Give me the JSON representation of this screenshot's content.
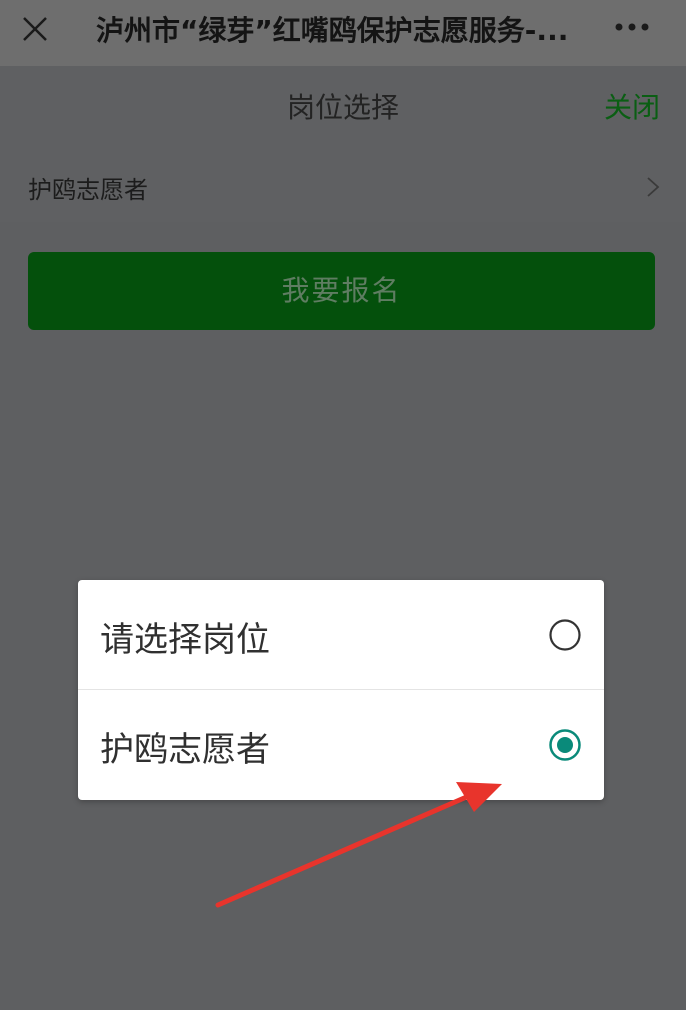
{
  "topbar": {
    "title": "泸州市“绿芽”红嘴鸥保护志愿服务-...",
    "close_icon": "close-icon",
    "more_icon": "more-icon"
  },
  "page": {
    "subtitle": "岗位选择",
    "close_label": "关闭"
  },
  "position_row": {
    "label": "护鸥志愿者",
    "icon": "chevron-right-icon"
  },
  "signup_button": {
    "label": "我要报名"
  },
  "picker": {
    "options": [
      {
        "label": "请选择岗位",
        "selected": false
      },
      {
        "label": "护鸥志愿者",
        "selected": true
      }
    ]
  },
  "colors": {
    "accent": "#0a8a7a",
    "brand_green": "#0a5e13",
    "annotation_arrow": "#e8342c"
  }
}
